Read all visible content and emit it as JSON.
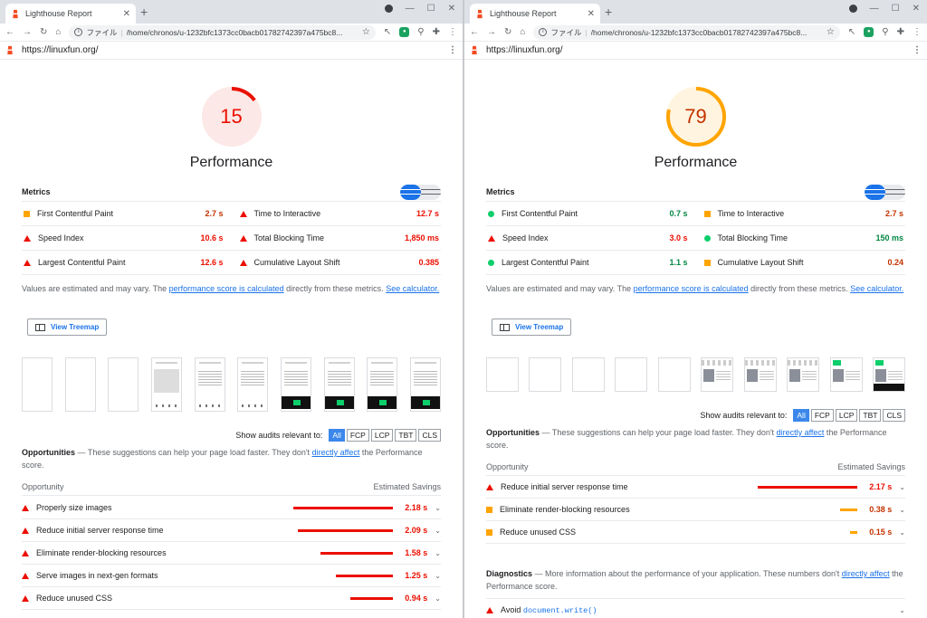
{
  "browser": {
    "tab_title": "Lighthouse Report",
    "new_tab_label": "+",
    "file_label": "ファイル",
    "url": "/home/chronos/u-1232bfc1373cc0bacb01782742397a475bc8...",
    "page_url": "https://linuxfun.org/"
  },
  "labels": {
    "performance": "Performance",
    "metrics": "Metrics",
    "note_prefix": "Values are estimated and may vary. The ",
    "note_link1": "performance score is calculated",
    "note_mid": " directly from these metrics. ",
    "note_link2": "See calculator.",
    "view_treemap": "View Treemap",
    "show_audits": "Show audits relevant to:",
    "filters": [
      "All",
      "FCP",
      "LCP",
      "TBT",
      "CLS"
    ],
    "opportunities_title": "Opportunities",
    "opportunities_desc": " — These suggestions can help your page load faster. They don't ",
    "opportunities_link": "directly affect",
    "opportunities_tail": " the Performance score.",
    "col_opportunity": "Opportunity",
    "col_savings": "Estimated Savings",
    "diagnostics_title": "Diagnostics",
    "diagnostics_desc": " — More information about the performance of your application. These numbers don't ",
    "diagnostics_link": "directly affect",
    "diagnostics_tail": " the Performance score."
  },
  "colors": {
    "fail": "#eb0f00",
    "average": "#ffa400",
    "pass": "#0cce6b"
  },
  "left": {
    "score": "15",
    "score_fraction": 0.15,
    "metrics": [
      [
        {
          "name": "First Contentful Paint",
          "value": "2.7 s",
          "rating": "average"
        },
        {
          "name": "Time to Interactive",
          "value": "12.7 s",
          "rating": "fail"
        }
      ],
      [
        {
          "name": "Speed Index",
          "value": "10.6 s",
          "rating": "fail"
        },
        {
          "name": "Total Blocking Time",
          "value": "1,850 ms",
          "rating": "fail"
        }
      ],
      [
        {
          "name": "Largest Contentful Paint",
          "value": "12.6 s",
          "rating": "fail"
        },
        {
          "name": "Cumulative Layout Shift",
          "value": "0.385",
          "rating": "fail"
        }
      ]
    ],
    "opportunities": [
      {
        "name": "Properly size images",
        "value": "2.18 s",
        "seconds": 2.18,
        "rating": "fail"
      },
      {
        "name": "Reduce initial server response time",
        "value": "2.09 s",
        "seconds": 2.09,
        "rating": "fail"
      },
      {
        "name": "Eliminate render-blocking resources",
        "value": "1.58 s",
        "seconds": 1.58,
        "rating": "fail"
      },
      {
        "name": "Serve images in next-gen formats",
        "value": "1.25 s",
        "seconds": 1.25,
        "rating": "fail"
      },
      {
        "name": "Reduce unused CSS",
        "value": "0.94 s",
        "seconds": 0.94,
        "rating": "fail"
      }
    ]
  },
  "right": {
    "score": "79",
    "score_fraction": 0.79,
    "metrics": [
      [
        {
          "name": "First Contentful Paint",
          "value": "0.7 s",
          "rating": "pass"
        },
        {
          "name": "Time to Interactive",
          "value": "2.7 s",
          "rating": "average"
        }
      ],
      [
        {
          "name": "Speed Index",
          "value": "3.0 s",
          "rating": "fail"
        },
        {
          "name": "Total Blocking Time",
          "value": "150 ms",
          "rating": "pass"
        }
      ],
      [
        {
          "name": "Largest Contentful Paint",
          "value": "1.1 s",
          "rating": "pass"
        },
        {
          "name": "Cumulative Layout Shift",
          "value": "0.24",
          "rating": "average"
        }
      ]
    ],
    "opportunities": [
      {
        "name": "Reduce initial server response time",
        "value": "2.17 s",
        "seconds": 2.17,
        "rating": "fail"
      },
      {
        "name": "Eliminate render-blocking resources",
        "value": "0.38 s",
        "seconds": 0.38,
        "rating": "average"
      },
      {
        "name": "Reduce unused CSS",
        "value": "0.15 s",
        "seconds": 0.15,
        "rating": "average"
      }
    ],
    "diagnostic_first": {
      "prefix": "Avoid ",
      "code": "document.write()"
    }
  }
}
